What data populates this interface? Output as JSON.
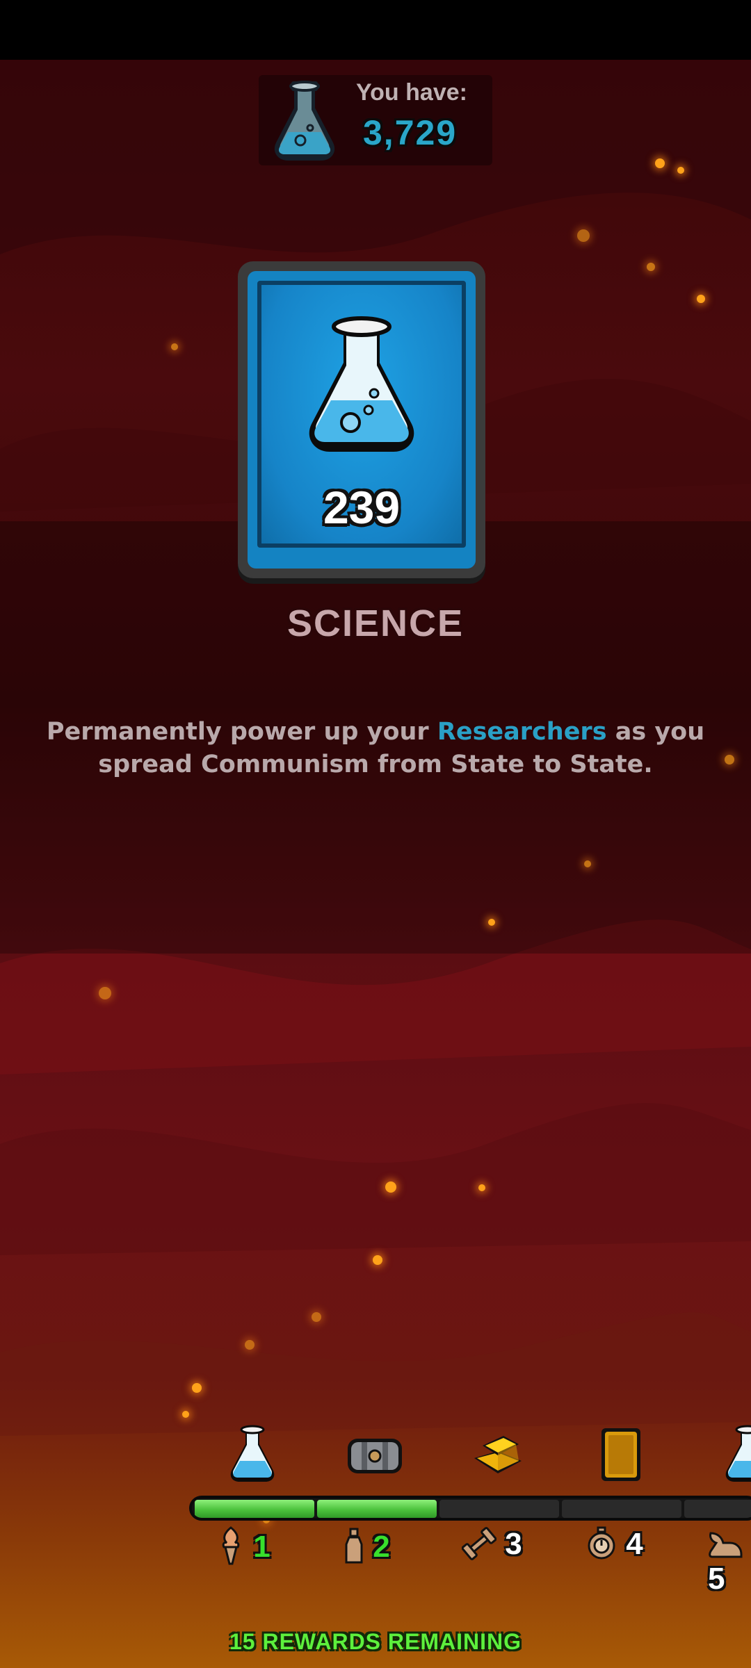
{
  "header": {
    "you_have_label": "You have:",
    "you_have_value": "3,729",
    "currency_icon": "science-flask-icon"
  },
  "card": {
    "icon": "science-flask-icon",
    "count": "239",
    "title": "SCIENCE"
  },
  "description": {
    "before": "Permanently power up your ",
    "highlight": "Researchers",
    "after": " as you spread Communism from State to State."
  },
  "rewards_track": {
    "items": [
      {
        "icon": "science-flask-icon"
      },
      {
        "icon": "treasure-chest-icon"
      },
      {
        "icon": "gold-bars-icon"
      },
      {
        "icon": "card-pack-icon"
      },
      {
        "icon": "science-flask-icon"
      }
    ],
    "milestones": [
      {
        "icon": "torch-icon",
        "value": "1"
      },
      {
        "icon": "bottle-icon",
        "value": "2"
      },
      {
        "icon": "dumbbell-icon",
        "value": "3"
      },
      {
        "icon": "stopwatch-icon",
        "value": "4"
      },
      {
        "icon": "winged-shoe-icon",
        "value": "5"
      }
    ],
    "progress": {
      "filled_segments": 2,
      "total_segments": 5
    },
    "remaining_text": "15 REWARDS REMAINING"
  },
  "colors": {
    "background": "#4a0a0d",
    "accent_blue": "#2aa6c9",
    "progress_green": "#4cc23d",
    "remaining_green": "#5df03c"
  }
}
